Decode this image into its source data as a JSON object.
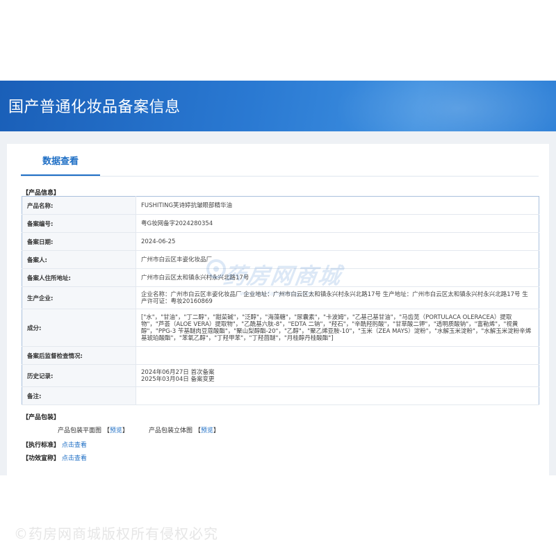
{
  "header": {
    "title": "国产普通化妆品备案信息"
  },
  "tabs": [
    {
      "label": "数据查看"
    }
  ],
  "product_info": {
    "section_label": "【产品信息】",
    "rows": [
      {
        "key": "产品名称:",
        "value": "FUSHITING芙诗婷抗皱眼部精华油"
      },
      {
        "key": "备案编号:",
        "value": "粤G妆网备字2024280354"
      },
      {
        "key": "备案日期:",
        "value": "2024-06-25"
      },
      {
        "key": "备案人:",
        "value": "广州市白云区丰姿化妆品厂"
      },
      {
        "key": "备案人住所地址:",
        "value": "广州市白云区太和镇永兴村永兴北路17号"
      },
      {
        "key": "生产企业:",
        "value": "企业名称：广州市白云区丰姿化妆品厂 企业地址：广州市白云区太和镇永兴村永兴北路17号 生产地址：广州市白云区太和镇永兴村永兴北路17号 生产许可证：粤妆20160869"
      },
      {
        "key": "成分:",
        "value": "[\"水\"，\"甘油\"，\"丁二醇\"，\"甜菜碱\"，\"泛醇\"，\"海藻糖\"，\"尿囊素\"，\"卡波姆\"，\"乙基己基甘油\"，\"马齿苋（PORTULACA OLERACEA）提取物\"，\"芦荟（ALOE VERA）提取物\"，\"乙酰基六肽-8\"，\"EDTA 二钠\"，\"羟石\"，\"辛酰羟肟酸\"，\"甘草酸二钾\"，\"透明质酸钠\"，\"富勒烯\"，\"视黄醇\"，\"PPG-3 苄基醚肉豆蔻酸酯\"，\"聚山梨醇酯-20\"，\"乙醇\"，\"聚乙烯亚胺-10\"，\"玉米（ZEA MAYS）淀粉\"，\"水解玉米淀粉\"，\"水解玉米淀粉辛烯基琥珀酸酯\"，\"苯氧乙醇\"，\"丁羟甲苯\"，\"丁羟茴醚\"，\"月桂醇丹桂酸酯\"]"
      },
      {
        "key": "备案后监督检查情况:",
        "value": ""
      },
      {
        "key": "历史记录:",
        "value": "2024年06月27日 首次备案\n2025年03月04日 备案变更"
      },
      {
        "key": "备注:",
        "value": ""
      }
    ]
  },
  "packaging": {
    "section_label": "【产品包装】",
    "flat_label": "产品包装平面图",
    "flat_link": "预览",
    "stereo_label": "产品包装立体图",
    "stereo_link": "预览",
    "bracket_open": "【",
    "bracket_close": "】"
  },
  "standard": {
    "label": "【执行标准】",
    "link": "点击查看"
  },
  "efficacy": {
    "label": "【功效宣称】",
    "link": "点击查看"
  },
  "watermark": {
    "text": "药房网商城",
    "url": "www.yaofangwang.com"
  },
  "copyright": "©药房网商城版权所有侵权必究",
  "colors": {
    "accent": "#1f6fc5",
    "banner": "#2a79d2",
    "border": "#a9c0dd"
  }
}
